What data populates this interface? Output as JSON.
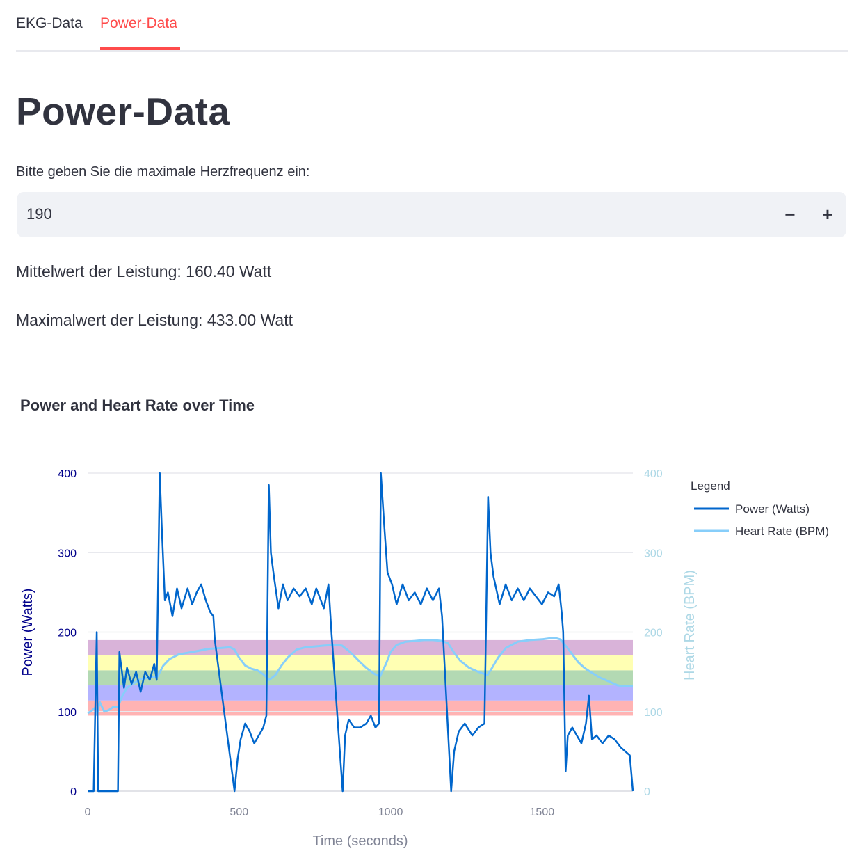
{
  "tabs": [
    {
      "label": "EKG-Data"
    },
    {
      "label": "Power-Data",
      "active": true
    }
  ],
  "page_title": "Power-Data",
  "hr_input": {
    "label": "Bitte geben Sie die maximale Herzfrequenz ein:",
    "value": "190",
    "minus": "−",
    "plus": "+"
  },
  "stats": {
    "mean": "Mittelwert der Leistung: 160.40 Watt",
    "max": "Maximalwert der Leistung: 433.00 Watt"
  },
  "colors": {
    "accent": "#ff4b4b",
    "power": "#0066cc",
    "heart_rate": "#87cefa"
  },
  "chart_data": {
    "type": "line",
    "title": "Power and Heart Rate over Time",
    "xlabel": "Time (seconds)",
    "ylabel_left": "Power (Watts)",
    "ylabel_right": "Heart Rate (BPM)",
    "xlim": [
      0,
      1800
    ],
    "ylim_left": [
      0,
      400
    ],
    "ylim_right": [
      0,
      400
    ],
    "x_ticks": [
      "0",
      "500",
      "1000",
      "1500"
    ],
    "y_ticks_left": [
      "0",
      "100",
      "200",
      "300",
      "400"
    ],
    "y_ticks_right": [
      "0",
      "100",
      "200",
      "300",
      "400"
    ],
    "grid": true,
    "legend": {
      "title": "Legend",
      "placement": "right"
    },
    "zones": [
      {
        "from": 95,
        "to": 114,
        "color": "#ff9999"
      },
      {
        "from": 114,
        "to": 133,
        "color": "#9999ff"
      },
      {
        "from": 133,
        "to": 152,
        "color": "#99cc99"
      },
      {
        "from": 152,
        "to": 171,
        "color": "#ffff99"
      },
      {
        "from": 171,
        "to": 190,
        "color": "#cc99cc"
      }
    ],
    "series": [
      {
        "name": "Power (Watts)",
        "axis": "left",
        "points": [
          [
            0,
            0
          ],
          [
            20,
            0
          ],
          [
            30,
            200
          ],
          [
            35,
            0
          ],
          [
            50,
            0
          ],
          [
            100,
            0
          ],
          [
            105,
            175
          ],
          [
            120,
            130
          ],
          [
            130,
            155
          ],
          [
            145,
            135
          ],
          [
            160,
            150
          ],
          [
            175,
            125
          ],
          [
            190,
            150
          ],
          [
            205,
            140
          ],
          [
            220,
            160
          ],
          [
            228,
            140
          ],
          [
            238,
            400
          ],
          [
            245,
            330
          ],
          [
            255,
            240
          ],
          [
            265,
            250
          ],
          [
            280,
            220
          ],
          [
            295,
            255
          ],
          [
            310,
            230
          ],
          [
            330,
            255
          ],
          [
            345,
            235
          ],
          [
            360,
            250
          ],
          [
            375,
            260
          ],
          [
            390,
            240
          ],
          [
            405,
            225
          ],
          [
            415,
            220
          ],
          [
            420,
            190
          ],
          [
            485,
            0
          ],
          [
            495,
            40
          ],
          [
            505,
            65
          ],
          [
            520,
            85
          ],
          [
            535,
            75
          ],
          [
            550,
            60
          ],
          [
            565,
            70
          ],
          [
            580,
            80
          ],
          [
            590,
            95
          ],
          [
            598,
            385
          ],
          [
            605,
            300
          ],
          [
            615,
            270
          ],
          [
            630,
            230
          ],
          [
            645,
            260
          ],
          [
            660,
            240
          ],
          [
            680,
            255
          ],
          [
            700,
            245
          ],
          [
            720,
            255
          ],
          [
            740,
            235
          ],
          [
            755,
            255
          ],
          [
            780,
            230
          ],
          [
            795,
            260
          ],
          [
            805,
            200
          ],
          [
            842,
            0
          ],
          [
            850,
            70
          ],
          [
            862,
            90
          ],
          [
            880,
            80
          ],
          [
            900,
            80
          ],
          [
            920,
            85
          ],
          [
            935,
            95
          ],
          [
            950,
            80
          ],
          [
            962,
            85
          ],
          [
            968,
            400
          ],
          [
            980,
            330
          ],
          [
            990,
            275
          ],
          [
            1005,
            260
          ],
          [
            1020,
            235
          ],
          [
            1040,
            260
          ],
          [
            1060,
            240
          ],
          [
            1080,
            250
          ],
          [
            1100,
            235
          ],
          [
            1120,
            255
          ],
          [
            1140,
            240
          ],
          [
            1160,
            255
          ],
          [
            1170,
            220
          ],
          [
            1200,
            0
          ],
          [
            1210,
            50
          ],
          [
            1225,
            75
          ],
          [
            1245,
            85
          ],
          [
            1270,
            70
          ],
          [
            1290,
            80
          ],
          [
            1310,
            85
          ],
          [
            1322,
            370
          ],
          [
            1330,
            300
          ],
          [
            1340,
            270
          ],
          [
            1360,
            235
          ],
          [
            1380,
            260
          ],
          [
            1400,
            240
          ],
          [
            1420,
            255
          ],
          [
            1440,
            240
          ],
          [
            1460,
            255
          ],
          [
            1480,
            245
          ],
          [
            1500,
            235
          ],
          [
            1520,
            250
          ],
          [
            1540,
            245
          ],
          [
            1555,
            260
          ],
          [
            1565,
            225
          ],
          [
            1570,
            200
          ],
          [
            1578,
            25
          ],
          [
            1585,
            70
          ],
          [
            1600,
            80
          ],
          [
            1615,
            70
          ],
          [
            1630,
            60
          ],
          [
            1645,
            85
          ],
          [
            1655,
            120
          ],
          [
            1665,
            65
          ],
          [
            1680,
            70
          ],
          [
            1700,
            60
          ],
          [
            1720,
            70
          ],
          [
            1740,
            65
          ],
          [
            1760,
            55
          ],
          [
            1775,
            50
          ],
          [
            1790,
            45
          ],
          [
            1800,
            0
          ]
        ]
      },
      {
        "name": "Heart Rate (BPM)",
        "axis": "right",
        "points": [
          [
            0,
            98
          ],
          [
            10,
            100
          ],
          [
            25,
            105
          ],
          [
            30,
            96
          ],
          [
            40,
            112
          ],
          [
            55,
            100
          ],
          [
            70,
            102
          ],
          [
            85,
            106
          ],
          [
            100,
            106
          ],
          [
            115,
            120
          ],
          [
            130,
            130
          ],
          [
            150,
            135
          ],
          [
            170,
            140
          ],
          [
            190,
            142
          ],
          [
            210,
            143
          ],
          [
            230,
            144
          ],
          [
            250,
            158
          ],
          [
            270,
            166
          ],
          [
            300,
            172
          ],
          [
            330,
            174
          ],
          [
            360,
            176
          ],
          [
            400,
            179
          ],
          [
            440,
            180
          ],
          [
            470,
            181
          ],
          [
            485,
            178
          ],
          [
            500,
            168
          ],
          [
            520,
            158
          ],
          [
            540,
            154
          ],
          [
            560,
            152
          ],
          [
            580,
            147
          ],
          [
            600,
            140
          ],
          [
            620,
            146
          ],
          [
            640,
            158
          ],
          [
            660,
            168
          ],
          [
            690,
            178
          ],
          [
            720,
            181
          ],
          [
            750,
            182
          ],
          [
            780,
            183
          ],
          [
            820,
            184
          ],
          [
            840,
            183
          ],
          [
            860,
            177
          ],
          [
            880,
            170
          ],
          [
            900,
            162
          ],
          [
            920,
            155
          ],
          [
            945,
            148
          ],
          [
            965,
            144
          ],
          [
            985,
            160
          ],
          [
            1000,
            175
          ],
          [
            1020,
            184
          ],
          [
            1050,
            188
          ],
          [
            1080,
            189
          ],
          [
            1110,
            190
          ],
          [
            1140,
            190
          ],
          [
            1170,
            189
          ],
          [
            1190,
            186
          ],
          [
            1210,
            174
          ],
          [
            1230,
            164
          ],
          [
            1260,
            155
          ],
          [
            1290,
            150
          ],
          [
            1320,
            146
          ],
          [
            1335,
            155
          ],
          [
            1355,
            168
          ],
          [
            1380,
            180
          ],
          [
            1420,
            188
          ],
          [
            1460,
            190
          ],
          [
            1500,
            191
          ],
          [
            1540,
            193
          ],
          [
            1560,
            191
          ],
          [
            1580,
            182
          ],
          [
            1600,
            172
          ],
          [
            1620,
            162
          ],
          [
            1640,
            155
          ],
          [
            1660,
            150
          ],
          [
            1690,
            143
          ],
          [
            1720,
            138
          ],
          [
            1750,
            133
          ],
          [
            1770,
            132
          ],
          [
            1800,
            132
          ]
        ]
      }
    ]
  }
}
